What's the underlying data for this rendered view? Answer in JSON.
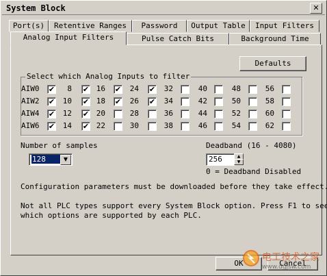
{
  "window": {
    "title": "System Block",
    "close_glyph": "✕"
  },
  "tabs_back": [
    "Port(s)",
    "Retentive Ranges",
    "Password",
    "Output Table",
    "Input Filters"
  ],
  "tabs_front": [
    "Analog Input Filters",
    "Pulse Catch Bits",
    "Background Time"
  ],
  "panel": {
    "defaults_label": "Defaults",
    "group_title": "Select which Analog Inputs to filter",
    "rows": [
      {
        "label": "AIW0",
        "cells": [
          {
            "n": "",
            "c": true
          },
          {
            "n": "8",
            "c": true
          },
          {
            "n": "16",
            "c": true
          },
          {
            "n": "24",
            "c": true
          },
          {
            "n": "32",
            "c": false
          },
          {
            "n": "40",
            "c": false
          },
          {
            "n": "48",
            "c": false
          },
          {
            "n": "56",
            "c": false
          }
        ]
      },
      {
        "label": "AIW2",
        "cells": [
          {
            "n": "",
            "c": true
          },
          {
            "n": "10",
            "c": true
          },
          {
            "n": "18",
            "c": true
          },
          {
            "n": "26",
            "c": true
          },
          {
            "n": "34",
            "c": false
          },
          {
            "n": "42",
            "c": false
          },
          {
            "n": "50",
            "c": false
          },
          {
            "n": "58",
            "c": false
          }
        ]
      },
      {
        "label": "AIW4",
        "cells": [
          {
            "n": "",
            "c": true
          },
          {
            "n": "12",
            "c": true
          },
          {
            "n": "20",
            "c": false
          },
          {
            "n": "28",
            "c": false
          },
          {
            "n": "36",
            "c": false
          },
          {
            "n": "44",
            "c": false
          },
          {
            "n": "52",
            "c": false
          },
          {
            "n": "60",
            "c": false
          }
        ]
      },
      {
        "label": "AIW6",
        "cells": [
          {
            "n": "",
            "c": true
          },
          {
            "n": "14",
            "c": true
          },
          {
            "n": "22",
            "c": false
          },
          {
            "n": "30",
            "c": false
          },
          {
            "n": "38",
            "c": false
          },
          {
            "n": "46",
            "c": false
          },
          {
            "n": "54",
            "c": false
          },
          {
            "n": "62",
            "c": false
          }
        ]
      }
    ],
    "samples_label": "Number of samples",
    "samples_value": "128",
    "deadband_label": "Deadband (16 - 4080)",
    "deadband_value": "256",
    "deadband_note": "0 = Deadband Disabled",
    "config_note": "Configuration parameters must be downloaded before they take effect.",
    "plc_note_1": "Not all PLC types support every System Block option.  Press F1 to see",
    "plc_note_2": "which options are supported by each PLC."
  },
  "footer": {
    "ok_label": "OK",
    "cancel_label": "Cancel"
  },
  "watermark": {
    "text": "电工技术之家",
    "url": "www.dgjsw.com"
  }
}
